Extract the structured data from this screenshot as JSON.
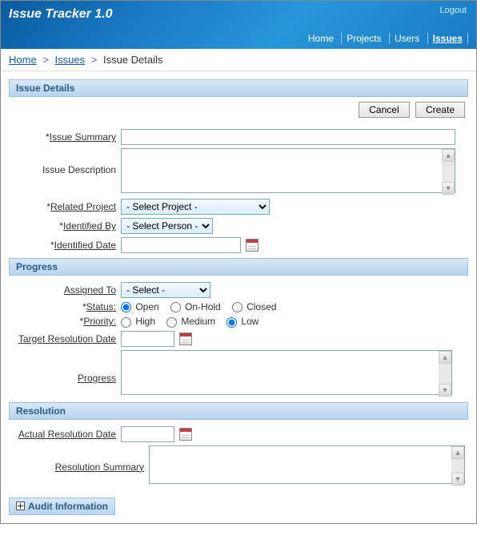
{
  "header": {
    "title": "Issue Tracker 1.0",
    "logout": "Logout"
  },
  "nav": {
    "items": [
      "Home",
      "Projects",
      "Users",
      "Issues"
    ],
    "active": "Issues"
  },
  "breadcrumb": {
    "home": "Home",
    "parent": "Issues",
    "current": "Issue Details"
  },
  "buttons": {
    "cancel": "Cancel",
    "create": "Create"
  },
  "section1": {
    "title": "Issue Details",
    "summary_lbl": "Issue Summary",
    "summary_val": "",
    "desc_lbl": "Issue Description",
    "desc_val": "",
    "project_lbl": "Related Project",
    "project_val": "- Select Project -",
    "ident_by_lbl": "Identified By",
    "ident_by_val": "- Select Person -",
    "ident_date_lbl": "Identified Date",
    "ident_date_val": ""
  },
  "section2": {
    "title": "Progress",
    "assigned_lbl": "Assigned To",
    "assigned_val": "- Select -",
    "status_lbl": "Status:",
    "status_opts": [
      "Open",
      "On-Hold",
      "Closed"
    ],
    "status_val": "Open",
    "priority_lbl": "Priority:",
    "priority_opts": [
      "High",
      "Medium",
      "Low"
    ],
    "priority_val": "Low",
    "target_lbl": "Target Resolution Date",
    "target_val": "",
    "progress_lbl": "Progress",
    "progress_val": ""
  },
  "section3": {
    "title": "Resolution",
    "actual_lbl": "Actual Resolution Date",
    "actual_val": "",
    "res_sum_lbl": "Resolution Summary",
    "res_sum_val": ""
  },
  "audit": {
    "title": "Audit Information"
  }
}
